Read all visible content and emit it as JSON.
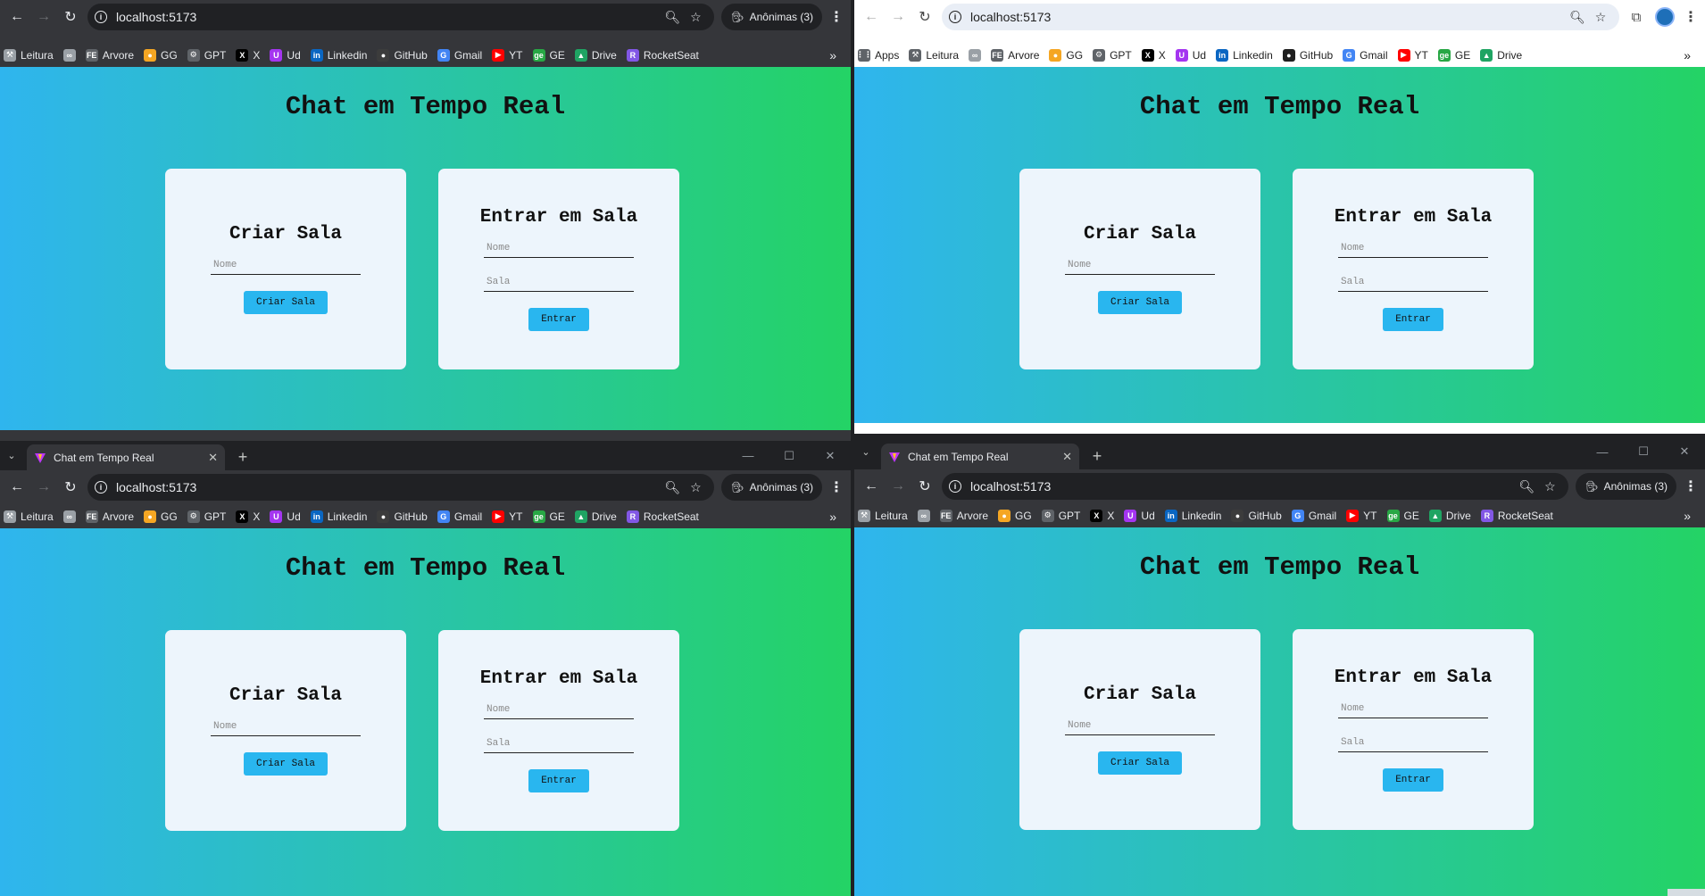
{
  "windows": {
    "top_left": {
      "address": {
        "url": "localhost:5173"
      },
      "incognito": {
        "label": "Anônimas (3)"
      }
    },
    "top_right": {
      "address": {
        "url": "localhost:5173"
      }
    },
    "bottom_left": {
      "tab": {
        "title": "Chat em Tempo Real"
      },
      "address": {
        "url": "localhost:5173"
      },
      "incognito": {
        "label": "Anônimas (3)"
      }
    },
    "bottom_right": {
      "tab": {
        "title": "Chat em Tempo Real"
      },
      "address": {
        "url": "localhost:5173"
      },
      "incognito": {
        "label": "Anônimas (3)"
      }
    }
  },
  "bookmarks_incognito": [
    {
      "label": "Leitura",
      "icon": "tool-icon",
      "color": "#9aa0a6"
    },
    {
      "label": "",
      "icon": "link-icon",
      "color": "#9aa0a6"
    },
    {
      "label": "Arvore",
      "icon": "fe-icon",
      "color": "#5f6368"
    },
    {
      "label": "GG",
      "icon": "location-pin-icon",
      "color": "#f5a623"
    },
    {
      "label": "GPT",
      "icon": "openai-icon",
      "color": "#5f6368"
    },
    {
      "label": "X",
      "icon": "x-icon",
      "color": "#000000"
    },
    {
      "label": "Ud",
      "icon": "udemy-icon",
      "color": "#a435f0"
    },
    {
      "label": "Linkedin",
      "icon": "linkedin-icon",
      "color": "#0a66c2"
    },
    {
      "label": "GitHub",
      "icon": "github-icon",
      "color": "#3c3c3c"
    },
    {
      "label": "Gmail",
      "icon": "google-icon",
      "color": "#4285f4"
    },
    {
      "label": "YT",
      "icon": "youtube-icon",
      "color": "#ff0000"
    },
    {
      "label": "GE",
      "icon": "ge-icon",
      "color": "#28a745"
    },
    {
      "label": "Drive",
      "icon": "drive-icon",
      "color": "#1fa463"
    },
    {
      "label": "RocketSeat",
      "icon": "rocketseat-icon",
      "color": "#8257e5"
    }
  ],
  "bookmarks_normal": [
    {
      "label": "Apps",
      "icon": "apps-grid-icon",
      "color": "#5f6368"
    },
    {
      "label": "Leitura",
      "icon": "tool-icon",
      "color": "#5f6368"
    },
    {
      "label": "",
      "icon": "link-icon",
      "color": "#9aa0a6"
    },
    {
      "label": "Arvore",
      "icon": "fe-icon",
      "color": "#5f6368"
    },
    {
      "label": "GG",
      "icon": "location-pin-icon",
      "color": "#f5a623"
    },
    {
      "label": "GPT",
      "icon": "openai-icon",
      "color": "#5f6368"
    },
    {
      "label": "X",
      "icon": "x-icon",
      "color": "#000000"
    },
    {
      "label": "Ud",
      "icon": "udemy-icon",
      "color": "#a435f0"
    },
    {
      "label": "Linkedin",
      "icon": "linkedin-icon",
      "color": "#0a66c2"
    },
    {
      "label": "GitHub",
      "icon": "github-icon",
      "color": "#1f1f1f"
    },
    {
      "label": "Gmail",
      "icon": "google-icon",
      "color": "#4285f4"
    },
    {
      "label": "YT",
      "icon": "youtube-icon",
      "color": "#ff0000"
    },
    {
      "label": "GE",
      "icon": "ge-icon",
      "color": "#28a745"
    },
    {
      "label": "Drive",
      "icon": "drive-icon",
      "color": "#1fa463"
    }
  ],
  "app": {
    "title": "Chat em Tempo Real",
    "create": {
      "heading": "Criar Sala",
      "name_placeholder": "Nome",
      "button": "Criar Sala"
    },
    "join": {
      "heading": "Entrar em Sala",
      "name_placeholder": "Nome",
      "room_placeholder": "Sala",
      "button": "Entrar"
    }
  },
  "colors": {
    "gradient_start": "#2fb5ee",
    "gradient_end": "#24d365",
    "button": "#29b6ef",
    "card": "#edf5fc"
  }
}
